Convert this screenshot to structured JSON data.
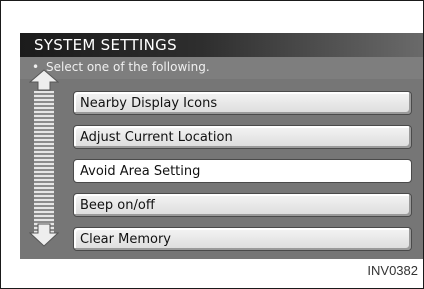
{
  "screen": {
    "title": "SYSTEM SETTINGS",
    "instruction_bullet": "•",
    "instruction": "Select one of the following."
  },
  "menu": {
    "items": [
      {
        "label": "Nearby Display Icons"
      },
      {
        "label": "Adjust Current Location"
      },
      {
        "label": "Avoid Area Setting",
        "selected": true
      },
      {
        "label": "Beep on/off"
      },
      {
        "label": "Clear Memory"
      }
    ]
  },
  "scrollbar": {
    "up_icon": "arrow-up-icon",
    "down_icon": "arrow-down-icon"
  },
  "caption": "INV0382"
}
